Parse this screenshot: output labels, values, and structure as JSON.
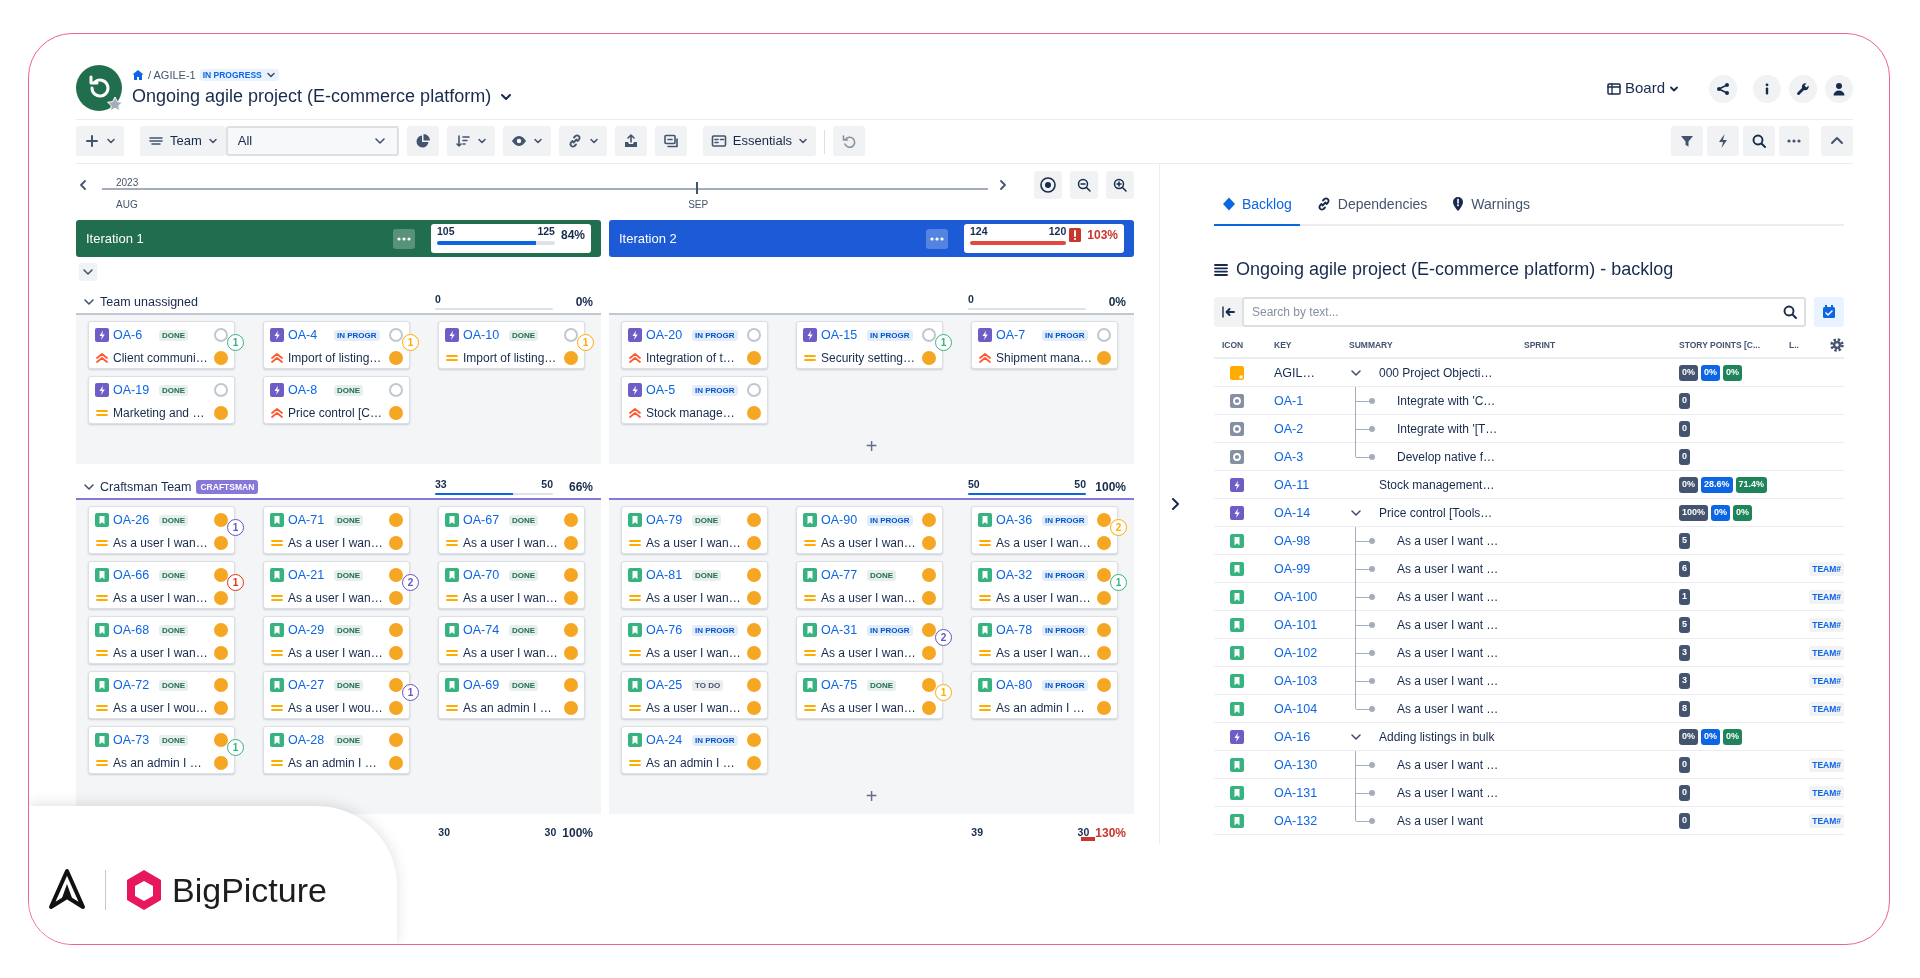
{
  "header": {
    "breadcrumb": "/ AGILE-1",
    "status": "IN PROGRESS",
    "title": "Ongoing agile project (E-commerce platform)",
    "view": "Board"
  },
  "toolbar": {
    "team_select": "Team",
    "filter_select": "All",
    "view_button": "Essentials"
  },
  "timeline": {
    "year": "2023",
    "months": [
      {
        "label": "AUG"
      },
      {
        "label": "SEP"
      }
    ]
  },
  "iterations": [
    {
      "name": "Iteration 1",
      "color": "#216e4e",
      "planned": "105",
      "capacity": "125",
      "percent": "84%",
      "level": 0.84,
      "over": false
    },
    {
      "name": "Iteration 2",
      "color": "#1d5bd6",
      "planned": "124",
      "capacity": "120",
      "percent": "103%",
      "level": 1,
      "over": true
    }
  ],
  "teams": [
    {
      "name": "Team unassigned",
      "color": "#c1c7d0",
      "expanded": true,
      "columns": [
        {
          "planned": "0",
          "percent": "0%",
          "level": 0,
          "cards": [
            {
              "key": "OA-6",
              "kind": "epic",
              "status": {
                "text": "DONE",
                "color": "#216e4e"
              },
              "high_priority": true,
              "summary": "Client communi…",
              "badge": {
                "text": "1",
                "color": "#36b37e"
              }
            },
            {
              "key": "OA-4",
              "kind": "epic",
              "status": {
                "text": "IN PROGR",
                "color": "#0055cc"
              },
              "high_priority": true,
              "summary": "Import of listing…",
              "badge": {
                "text": "1",
                "color": "#ffab00"
              }
            },
            {
              "key": "OA-10",
              "kind": "epic",
              "status": {
                "text": "DONE",
                "color": "#216e4e"
              },
              "high_priority": false,
              "summary": "Import of listing…",
              "badge": {
                "text": "1",
                "color": "#ffab00"
              }
            },
            {
              "key": "OA-19",
              "kind": "epic",
              "status": {
                "text": "DONE",
                "color": "#216e4e"
              },
              "high_priority": false,
              "summary": "Marketing and …"
            },
            {
              "key": "OA-8",
              "kind": "epic",
              "status": {
                "text": "DONE",
                "color": "#216e4e"
              },
              "high_priority": true,
              "summary": "Price control [C…"
            }
          ]
        },
        {
          "planned": "0",
          "percent": "0%",
          "level": 0,
          "add": "+",
          "cards": [
            {
              "key": "OA-20",
              "kind": "epic",
              "status": {
                "text": "IN PROGR",
                "color": "#0055cc"
              },
              "high_priority": true,
              "summary": "Integration of t…"
            },
            {
              "key": "OA-15",
              "kind": "epic",
              "status": {
                "text": "IN PROGR",
                "color": "#0055cc"
              },
              "high_priority": false,
              "summary": "Security setting…",
              "badge": {
                "text": "1",
                "color": "#36b37e"
              }
            },
            {
              "key": "OA-7",
              "kind": "epic",
              "status": {
                "text": "IN PROGR",
                "color": "#0055cc"
              },
              "high_priority": true,
              "summary": "Shipment mana…"
            },
            {
              "key": "OA-5",
              "kind": "epic",
              "status": {
                "text": "IN PROGR",
                "color": "#0055cc"
              },
              "high_priority": true,
              "summary": "Stock manage…"
            }
          ]
        }
      ]
    },
    {
      "name": "Craftsman Team",
      "tag": "CRAFTSMAN",
      "color": "#8777d9",
      "expanded": true,
      "columns": [
        {
          "planned": "33",
          "capacity": "50",
          "percent": "66%",
          "level": 0.66,
          "cards": [
            {
              "key": "OA-26",
              "kind": "story",
              "status": {
                "text": "DONE",
                "color": "#216e4e"
              },
              "high_priority": false,
              "summary": "As a user I wan…",
              "badge": {
                "text": "1",
                "color": "#6554c0"
              }
            },
            {
              "key": "OA-71",
              "kind": "story",
              "status": {
                "text": "DONE",
                "color": "#216e4e"
              },
              "high_priority": false,
              "summary": "As a user I wan…"
            },
            {
              "key": "OA-67",
              "kind": "story",
              "status": {
                "text": "DONE",
                "color": "#216e4e"
              },
              "high_priority": false,
              "summary": "As a user I wan…"
            },
            {
              "key": "OA-66",
              "kind": "story",
              "status": {
                "text": "DONE",
                "color": "#216e4e"
              },
              "high_priority": false,
              "summary": "As a user I wan…",
              "badge": {
                "text": "1",
                "color": "#de350b"
              }
            },
            {
              "key": "OA-21",
              "kind": "story",
              "status": {
                "text": "DONE",
                "color": "#216e4e"
              },
              "high_priority": false,
              "summary": "As a user I wan…",
              "badge": {
                "text": "2",
                "color": "#6554c0"
              }
            },
            {
              "key": "OA-70",
              "kind": "story",
              "status": {
                "text": "DONE",
                "color": "#216e4e"
              },
              "high_priority": false,
              "summary": "As a user I wan…"
            },
            {
              "key": "OA-68",
              "kind": "story",
              "status": {
                "text": "DONE",
                "color": "#216e4e"
              },
              "high_priority": false,
              "summary": "As a user I wan…"
            },
            {
              "key": "OA-29",
              "kind": "story",
              "status": {
                "text": "DONE",
                "color": "#216e4e"
              },
              "high_priority": false,
              "summary": "As a user I wan…"
            },
            {
              "key": "OA-74",
              "kind": "story",
              "status": {
                "text": "DONE",
                "color": "#216e4e"
              },
              "high_priority": false,
              "summary": "As a user I wan…"
            },
            {
              "key": "OA-72",
              "kind": "story",
              "status": {
                "text": "DONE",
                "color": "#216e4e"
              },
              "high_priority": false,
              "summary": "As a user I wou…"
            },
            {
              "key": "OA-27",
              "kind": "story",
              "status": {
                "text": "DONE",
                "color": "#216e4e"
              },
              "high_priority": false,
              "summary": "As a user I wou…",
              "badge": {
                "text": "1",
                "color": "#6554c0"
              }
            },
            {
              "key": "OA-69",
              "kind": "story",
              "status": {
                "text": "DONE",
                "color": "#216e4e"
              },
              "high_priority": false,
              "summary": "As an admin I …"
            },
            {
              "key": "OA-73",
              "kind": "story",
              "status": {
                "text": "DONE",
                "color": "#216e4e"
              },
              "high_priority": false,
              "summary": "As an admin I …",
              "badge": {
                "text": "1",
                "color": "#36b37e"
              }
            },
            {
              "key": "OA-28",
              "kind": "story",
              "status": {
                "text": "DONE",
                "color": "#216e4e"
              },
              "high_priority": false,
              "summary": "As an admin I …"
            }
          ]
        },
        {
          "planned": "50",
          "capacity": "50",
          "percent": "100%",
          "level": 1,
          "add": "+",
          "cards": [
            {
              "key": "OA-79",
              "kind": "story",
              "status": {
                "text": "DONE",
                "color": "#216e4e"
              },
              "high_priority": false,
              "summary": "As a user I wan…"
            },
            {
              "key": "OA-90",
              "kind": "story",
              "status": {
                "text": "IN PROGR",
                "color": "#0055cc"
              },
              "high_priority": false,
              "summary": "As a user I wan…"
            },
            {
              "key": "OA-36",
              "kind": "story",
              "status": {
                "text": "IN PROGR",
                "color": "#0055cc"
              },
              "high_priority": false,
              "summary": "As a user I wan…",
              "badge": {
                "text": "2",
                "color": "#ffab00"
              }
            },
            {
              "key": "OA-81",
              "kind": "story",
              "status": {
                "text": "DONE",
                "color": "#216e4e"
              },
              "high_priority": false,
              "summary": "As a user I wan…"
            },
            {
              "key": "OA-77",
              "kind": "story",
              "status": {
                "text": "DONE",
                "color": "#216e4e"
              },
              "high_priority": false,
              "summary": "As a user I wan…"
            },
            {
              "key": "OA-32",
              "kind": "story",
              "status": {
                "text": "IN PROGR",
                "color": "#0055cc"
              },
              "high_priority": false,
              "summary": "As a user I wan…",
              "badge": {
                "text": "1",
                "color": "#36b37e"
              }
            },
            {
              "key": "OA-76",
              "kind": "story",
              "status": {
                "text": "IN PROGR",
                "color": "#0055cc"
              },
              "high_priority": false,
              "summary": "As a user I wan…"
            },
            {
              "key": "OA-31",
              "kind": "story",
              "status": {
                "text": "IN PROGR",
                "color": "#0055cc"
              },
              "high_priority": false,
              "summary": "As a user I wan…",
              "badge": {
                "text": "2",
                "color": "#6554c0"
              }
            },
            {
              "key": "OA-78",
              "kind": "story",
              "status": {
                "text": "IN PROGR",
                "color": "#0055cc"
              },
              "high_priority": false,
              "summary": "As a user I wan…"
            },
            {
              "key": "OA-25",
              "kind": "story",
              "status": {
                "text": "TO DO",
                "color": "#44546f"
              },
              "high_priority": false,
              "summary": "As a user I wan…"
            },
            {
              "key": "OA-75",
              "kind": "story",
              "status": {
                "text": "DONE",
                "color": "#216e4e"
              },
              "high_priority": false,
              "summary": "As a user I wan…",
              "badge": {
                "text": "1",
                "color": "#ffab00"
              }
            },
            {
              "key": "OA-80",
              "kind": "story",
              "status": {
                "text": "IN PROGR",
                "color": "#0055cc"
              },
              "high_priority": false,
              "summary": "As an admin I …"
            },
            {
              "key": "OA-24",
              "kind": "story",
              "status": {
                "text": "IN PROGR",
                "color": "#0055cc"
              },
              "high_priority": false,
              "summary": "As an admin I …"
            }
          ]
        }
      ]
    }
  ],
  "totals": [
    {
      "planned": "30",
      "capacity": "30",
      "percent": "100%",
      "over": false
    },
    {
      "planned": "39",
      "capacity": "30",
      "percent": "130%",
      "over": true
    }
  ],
  "panel": {
    "tabs": [
      {
        "label": "Backlog",
        "selected": true
      },
      {
        "label": "Dependencies",
        "selected": false
      },
      {
        "label": "Warnings",
        "selected": false
      }
    ],
    "title": "Ongoing agile project (E-commerce platform) - backlog",
    "search_placeholder": "Search by text...",
    "columns": [
      "ICON",
      "KEY",
      "SUMMARY",
      "SPRINT",
      "STORY POINTS [C...",
      "L.."
    ],
    "rows": [
      {
        "kind": "initiative",
        "key": "AGIL…",
        "link": false,
        "summary": "000 Project Objecti…",
        "expanded": true,
        "points": [
          {
            "text": "0%",
            "color": "#44546f"
          },
          {
            "text": "0%",
            "color": "#0c66e4"
          },
          {
            "text": "0%",
            "color": "#1f845a"
          }
        ],
        "children": [
          {
            "kind": "task",
            "key": "OA-1",
            "link": true,
            "summary": "Integrate with 'C…",
            "points": [
              {
                "text": "0",
                "color": "#44546f"
              }
            ]
          },
          {
            "kind": "task",
            "key": "OA-2",
            "link": true,
            "summary": "Integrate with '[T…",
            "points": [
              {
                "text": "0",
                "color": "#44546f"
              }
            ]
          },
          {
            "kind": "task",
            "key": "OA-3",
            "link": true,
            "summary": "Develop native f…",
            "points": [
              {
                "text": "0",
                "color": "#44546f"
              }
            ]
          }
        ]
      },
      {
        "kind": "epic",
        "key": "OA-11",
        "link": true,
        "summary": "Stock management…",
        "points": [
          {
            "text": "0%",
            "color": "#44546f"
          },
          {
            "text": "28.6%",
            "color": "#0c66e4"
          },
          {
            "text": "71.4%",
            "color": "#1f845a"
          }
        ]
      },
      {
        "kind": "epic",
        "key": "OA-14",
        "link": true,
        "summary": "Price control [Tools…",
        "expanded": true,
        "points": [
          {
            "text": "100%",
            "color": "#44546f"
          },
          {
            "text": "0%",
            "color": "#0c66e4"
          },
          {
            "text": "0%",
            "color": "#1f845a"
          }
        ],
        "children": [
          {
            "kind": "story",
            "key": "OA-98",
            "link": true,
            "summary": "As a user I want …",
            "points": [
              {
                "text": "5",
                "color": "#44546f"
              }
            ]
          },
          {
            "kind": "story",
            "key": "OA-99",
            "link": true,
            "summary": "As a user I want …",
            "points": [
              {
                "text": "6",
                "color": "#44546f"
              }
            ],
            "team": "TEAM#"
          },
          {
            "kind": "story",
            "key": "OA-100",
            "link": true,
            "summary": "As a user I want …",
            "points": [
              {
                "text": "1",
                "color": "#44546f"
              }
            ],
            "team": "TEAM#"
          },
          {
            "kind": "story",
            "key": "OA-101",
            "link": true,
            "summary": "As a user I want …",
            "points": [
              {
                "text": "5",
                "color": "#44546f"
              }
            ],
            "team": "TEAM#"
          },
          {
            "kind": "story",
            "key": "OA-102",
            "link": true,
            "summary": "As a user I want …",
            "points": [
              {
                "text": "3",
                "color": "#44546f"
              }
            ],
            "team": "TEAM#"
          },
          {
            "kind": "story",
            "key": "OA-103",
            "link": true,
            "summary": "As a user I want …",
            "points": [
              {
                "text": "3",
                "color": "#44546f"
              }
            ],
            "team": "TEAM#"
          },
          {
            "kind": "story",
            "key": "OA-104",
            "link": true,
            "summary": "As a user I want …",
            "points": [
              {
                "text": "8",
                "color": "#44546f"
              }
            ],
            "team": "TEAM#"
          }
        ]
      },
      {
        "kind": "epic",
        "key": "OA-16",
        "link": true,
        "summary": "Adding listings in bulk",
        "expanded": true,
        "points": [
          {
            "text": "0%",
            "color": "#44546f"
          },
          {
            "text": "0%",
            "color": "#0c66e4"
          },
          {
            "text": "0%",
            "color": "#1f845a"
          }
        ],
        "children": [
          {
            "kind": "story",
            "key": "OA-130",
            "link": true,
            "summary": "As a user I want …",
            "points": [
              {
                "text": "0",
                "color": "#44546f"
              }
            ],
            "team": "TEAM#"
          },
          {
            "kind": "story",
            "key": "OA-131",
            "link": true,
            "summary": "As a user I want …",
            "points": [
              {
                "text": "0",
                "color": "#44546f"
              }
            ],
            "team": "TEAM#"
          },
          {
            "kind": "story",
            "key": "OA-132",
            "link": true,
            "summary": "As a user I want",
            "points": [
              {
                "text": "0",
                "color": "#44546f"
              }
            ],
            "team": "TEAM#"
          }
        ]
      }
    ]
  },
  "brand": {
    "name": "BigPicture"
  }
}
